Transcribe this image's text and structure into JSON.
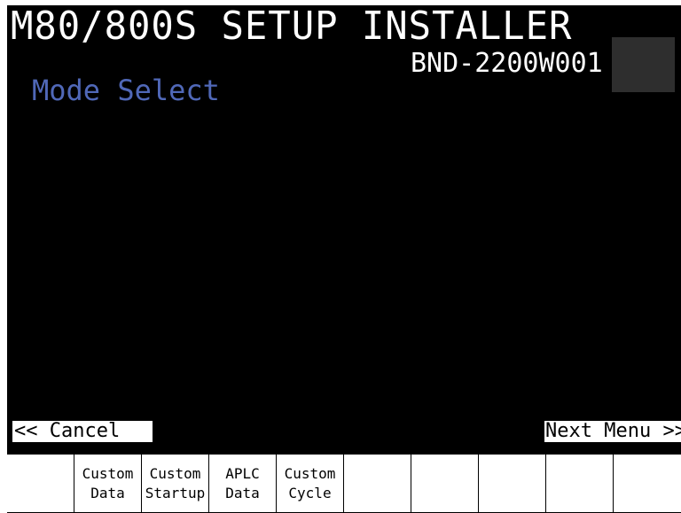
{
  "header": {
    "title": "M80/800S SETUP INSTALLER",
    "version": "BND-2200W001"
  },
  "mode_label": "Mode Select",
  "nav": {
    "cancel_label": "<< Cancel",
    "next_label": "Next Menu >>"
  },
  "function_keys": [
    {
      "label": ""
    },
    {
      "label": "Custom\nData"
    },
    {
      "label": "Custom\nStartup"
    },
    {
      "label": "APLC\nData"
    },
    {
      "label": "Custom\nCycle"
    },
    {
      "label": ""
    },
    {
      "label": ""
    },
    {
      "label": ""
    },
    {
      "label": ""
    },
    {
      "label": ""
    }
  ],
  "colors": {
    "background": "#000000",
    "title_text": "#ffffff",
    "mode_text": "#5068b8",
    "button_bg": "#ffffff"
  }
}
